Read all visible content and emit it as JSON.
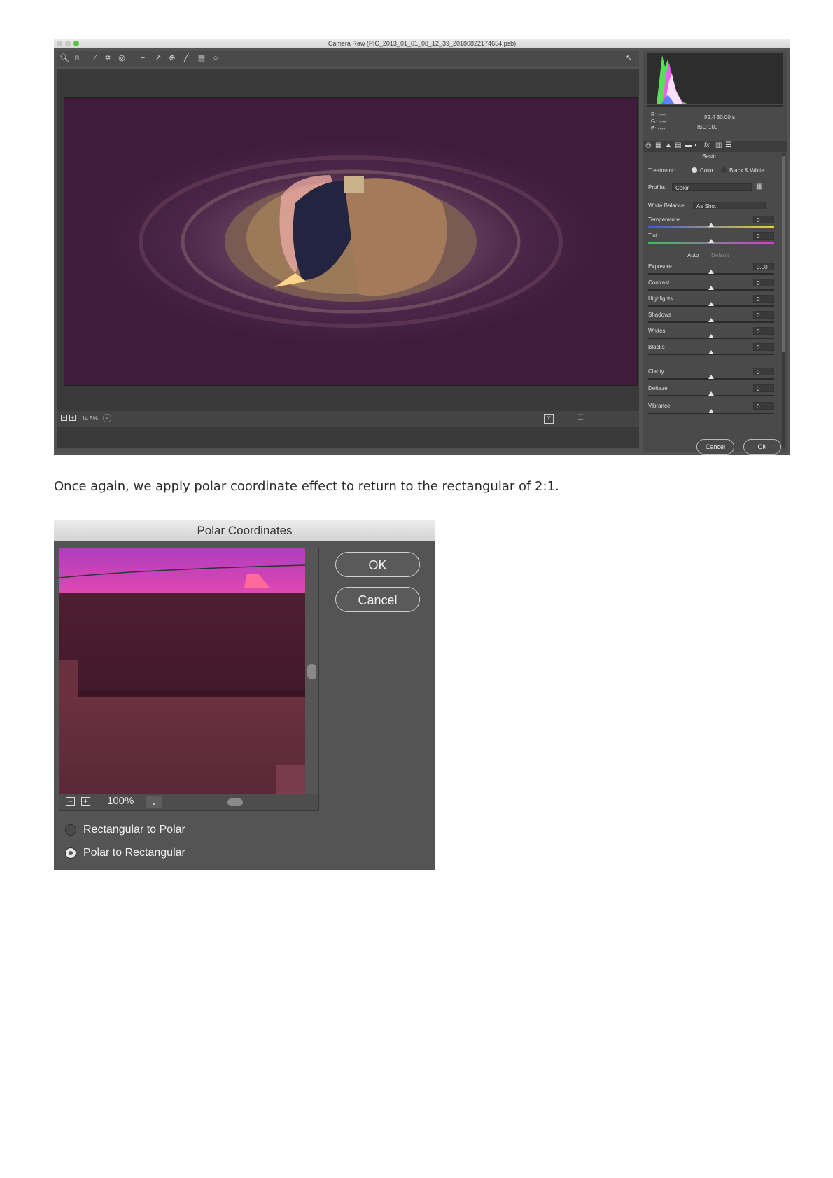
{
  "camera_raw": {
    "title": "Camera Raw (PIC_2013_01_01_08_12_39_20180822174654.psb)",
    "zoom": "14.5%",
    "exif": {
      "r": "R:  ----",
      "g": "G:  ----",
      "b": "B:  ----",
      "aperture_shutter": "f/2.4   30.00 s",
      "iso": "ISO 100"
    },
    "panel_title": "Basic",
    "treatment_label": "Treatment:",
    "treatment_color": "Color",
    "treatment_bw": "Black & White",
    "profile_label": "Profile:",
    "profile_value": "Color",
    "white_balance_label": "White Balance:",
    "white_balance_value": "As Shot",
    "auto_link": "Auto",
    "default_link": "Default",
    "sliders": [
      {
        "label": "Temperature",
        "value": "0"
      },
      {
        "label": "Tint",
        "value": "0"
      },
      {
        "label": "Exposure",
        "value": "0.00"
      },
      {
        "label": "Contrast",
        "value": "0"
      },
      {
        "label": "Highlights",
        "value": "0"
      },
      {
        "label": "Shadows",
        "value": "0"
      },
      {
        "label": "Whites",
        "value": "0"
      },
      {
        "label": "Blacks",
        "value": "0"
      },
      {
        "label": "Clarity",
        "value": "0"
      },
      {
        "label": "Dehaze",
        "value": "0"
      },
      {
        "label": "Vibrance",
        "value": "0"
      }
    ],
    "cancel_label": "Cancel",
    "ok_label": "OK"
  },
  "caption": "Once again, we apply polar coordinate effect to return to the rectangular of 2:1.",
  "polar_dialog": {
    "title": "Polar Coordinates",
    "ok_label": "OK",
    "cancel_label": "Cancel",
    "zoom": "100%",
    "option_1": "Rectangular to Polar",
    "option_2": "Polar to Rectangular",
    "selected_option": "Polar to Rectangular"
  }
}
